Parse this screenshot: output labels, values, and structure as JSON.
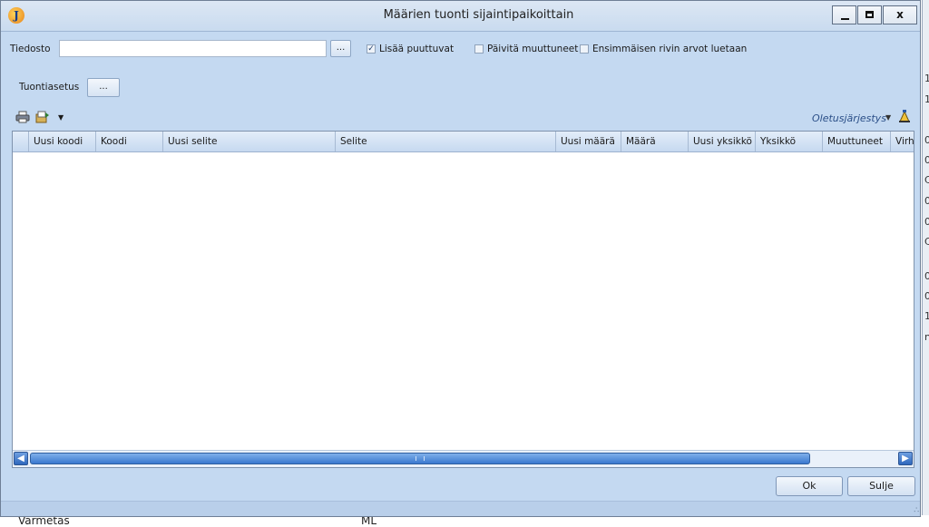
{
  "window": {
    "title": "Määrien tuonti sijaintipaikoittain",
    "app_icon_letter": "J",
    "close_label": "x"
  },
  "file_row": {
    "file_label": "Tiedosto",
    "file_value": "",
    "browse_label": "...",
    "add_missing": {
      "label": "Lisää puuttuvat",
      "checked": true
    },
    "update_changed": {
      "label": "Päivitä muuttuneet",
      "checked": false
    },
    "first_row_values": {
      "label": "Ensimmäisen rivin arvot luetaan",
      "checked": false
    }
  },
  "import_settings": {
    "label": "Tuontiasetus",
    "button_label": "..."
  },
  "toolbar": {
    "icons": [
      "print-icon",
      "export-icon",
      "dropdown-arrow-icon"
    ],
    "order_label": "Oletusjärjestys",
    "order_arrow": "▼",
    "sort_icon": "sort-settings-icon"
  },
  "grid": {
    "columns": [
      "Uusi koodi",
      "Koodi",
      "Uusi selite",
      "Selite",
      "Uusi määrä",
      "Määrä",
      "Uusi yksikkö",
      "Yksikkö",
      "Muuttuneet",
      "Virhe"
    ],
    "rows": [],
    "scroll_left": "◀",
    "scroll_right": "▶"
  },
  "buttons": {
    "ok": "Ok",
    "close": "Sulje"
  },
  "background": {
    "bottom_left_text": "Varmetas",
    "bottom_mid_text": "ML",
    "right_edge_chars": [
      "1",
      "1",
      "0",
      "0",
      "C",
      "0",
      "0",
      "C",
      "0",
      "0",
      "1",
      "n"
    ]
  },
  "colors": {
    "dialog_bg": "#c4d9f1",
    "grid_bg": "#ffffff",
    "scrollbar_blue": "#3a78cf",
    "accent_text": "#2b4f88"
  }
}
